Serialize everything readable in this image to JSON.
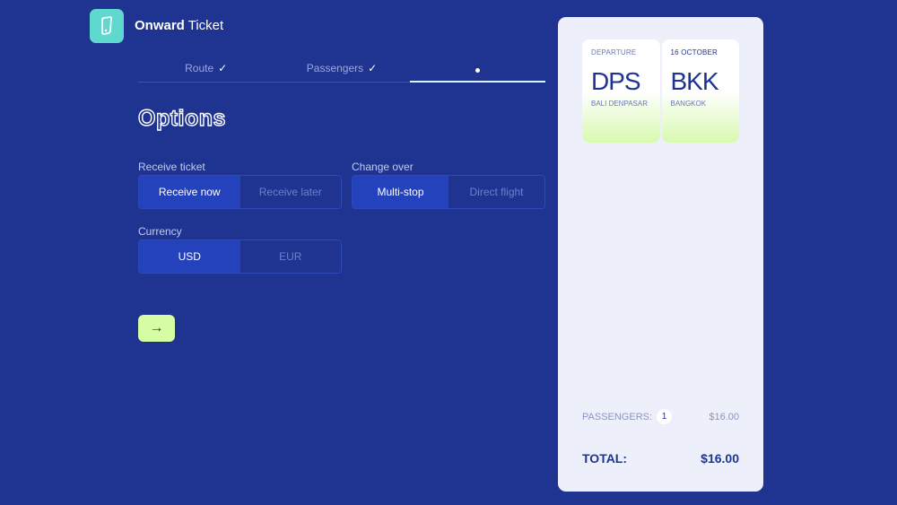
{
  "brand": {
    "name_bold": "Onward",
    "name_rest": " Ticket",
    "logo_icon": "phone-icon"
  },
  "steps": [
    {
      "label": "Route",
      "done": true
    },
    {
      "label": "Passengers",
      "done": true
    },
    {
      "label": "",
      "done": false
    }
  ],
  "options": {
    "title": "Options",
    "receive": {
      "label": "Receive ticket",
      "options": [
        "Receive now",
        "Receive later"
      ],
      "selected": "Receive now"
    },
    "change": {
      "label": "Change over",
      "options": [
        "Multi-stop",
        "Direct flight"
      ],
      "selected": "Multi-stop"
    },
    "currency": {
      "label": "Currency",
      "options": [
        "USD",
        "EUR"
      ],
      "selected": "USD"
    },
    "next_label": "→"
  },
  "summary": {
    "departure_label": "DEPARTURE",
    "date": "16 OCTOBER",
    "from_code": "DPS",
    "from_city": "BALI DENPASAR",
    "to_code": "BKK",
    "to_city": "BANGKOK",
    "passengers_label": "PASSENGERS:",
    "passengers_count": "1",
    "passengers_price": "$16.00",
    "total_label": "TOTAL:",
    "total_price": "$16.00"
  },
  "colors": {
    "background": "#1e3490",
    "accent": "#d6fca4",
    "logo": "#5fd8cf"
  }
}
